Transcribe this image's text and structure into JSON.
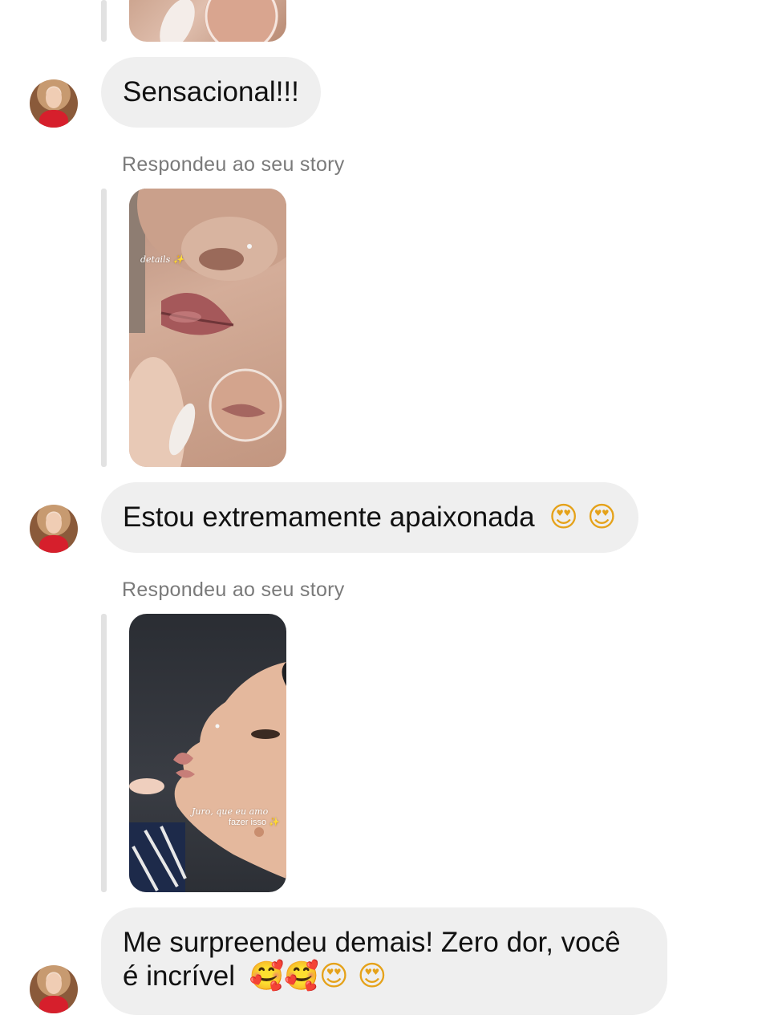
{
  "messages": [
    {
      "text": "Sensacional!!!"
    },
    {
      "reply_label": "Respondeu ao seu story",
      "story_caption": "details ✨",
      "text": "Estou extremamente apaixonada",
      "emojis": "😍 😍"
    },
    {
      "reply_label": "Respondeu ao seu story",
      "story_caption_1": "Juro, que eu amo",
      "story_caption_2": "fazer isso ✨",
      "text_line1": "Me surpreendeu demais! Zero dor, você",
      "text_line2": "é incrível",
      "emojis": "🥰🥰😍 😍"
    }
  ],
  "colors": {
    "bubble": "#efefef",
    "reply_label": "#7a7a7a",
    "reply_bar": "#e2e2e2",
    "avatar_shirt": "#d61f2c"
  }
}
